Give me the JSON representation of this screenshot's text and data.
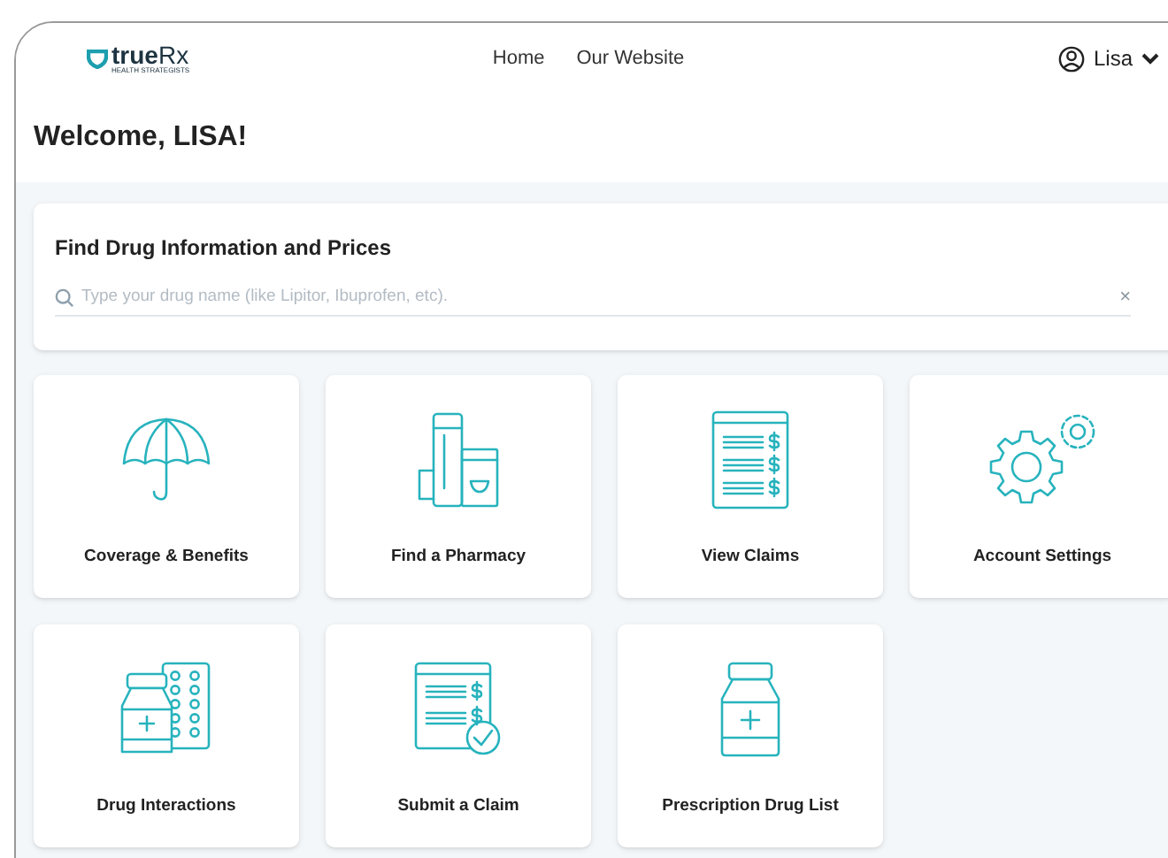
{
  "header": {
    "logo": {
      "brand_bold": "true",
      "brand_light": "Rx",
      "tagline": "HEALTH STRATEGISTS"
    },
    "nav": [
      "Home",
      "Our Website"
    ],
    "user": {
      "name": "Lisa"
    }
  },
  "welcome": "Welcome, LISA!",
  "search_card": {
    "title": "Find Drug Information and Prices",
    "placeholder": "Type your drug name (like Lipitor, Ibuprofen, etc).",
    "clear": "×"
  },
  "tiles": [
    {
      "label": "Coverage & Benefits"
    },
    {
      "label": "Find a Pharmacy"
    },
    {
      "label": "View Claims"
    },
    {
      "label": "Account Settings"
    },
    {
      "label": "Drug Interactions"
    },
    {
      "label": "Submit a Claim"
    },
    {
      "label": "Prescription Drug List"
    }
  ]
}
